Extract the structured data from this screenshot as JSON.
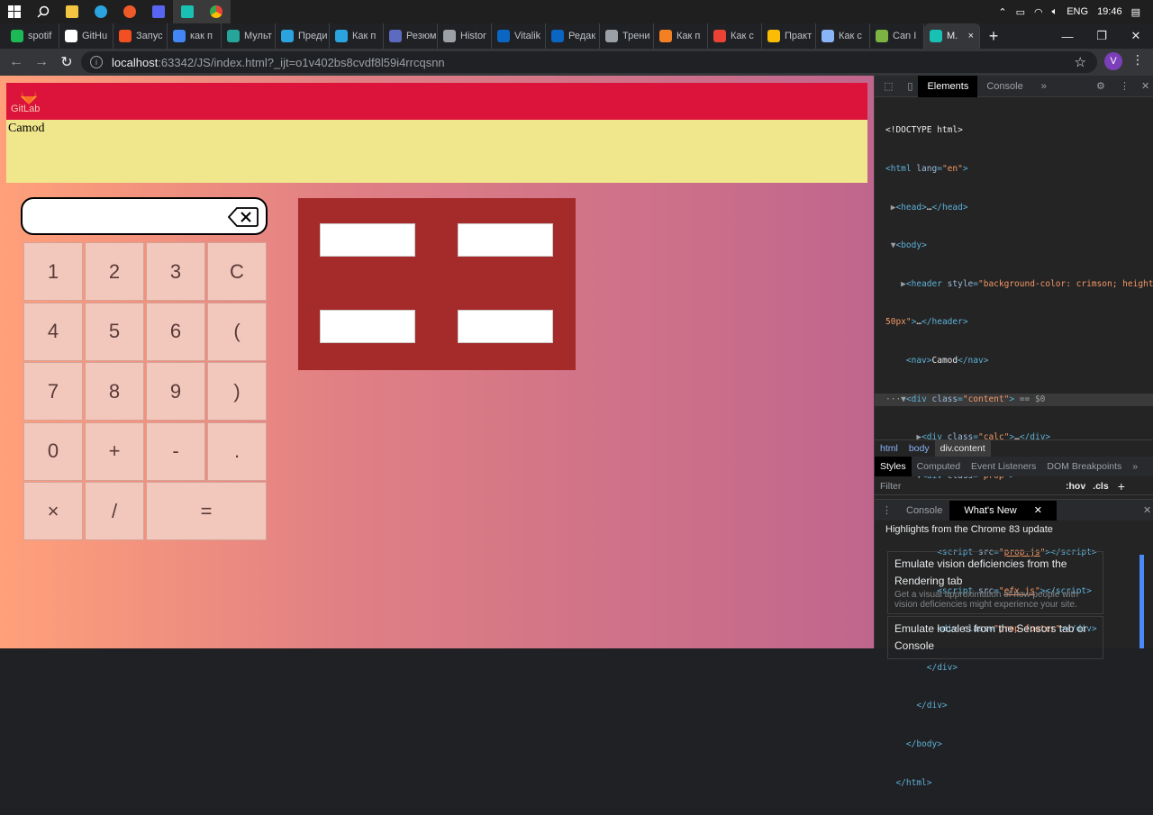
{
  "taskbar": {
    "clock": "19:46",
    "language": "ENG",
    "icons": [
      "windows-start",
      "search",
      "file-explorer",
      "telegram",
      "media-player",
      "discord",
      "jetbrains-webstorm",
      "chrome"
    ]
  },
  "browser": {
    "tabs": [
      {
        "label": "spotif",
        "icon": "spotify-icon",
        "color": "#1db954"
      },
      {
        "label": "GitHu",
        "icon": "github-icon",
        "color": "#ffffff"
      },
      {
        "label": "Запус",
        "icon": "microsoft-icon",
        "color": "#f25022"
      },
      {
        "label": "как п",
        "icon": "google-icon",
        "color": "#4285f4"
      },
      {
        "label": "Мульт",
        "icon": "glasses-icon",
        "color": "#26a69a"
      },
      {
        "label": "Преди",
        "icon": "telegram-icon",
        "color": "#2aa3df"
      },
      {
        "label": "Как п",
        "icon": "telegram-icon",
        "color": "#2aa3df"
      },
      {
        "label": "Резюм",
        "icon": "resume-icon",
        "color": "#5c6bc0"
      },
      {
        "label": "Histor",
        "icon": "history-icon",
        "color": "#9aa0a6"
      },
      {
        "label": "Vitalik",
        "icon": "linkedin-icon",
        "color": "#0a66c2"
      },
      {
        "label": "Редак",
        "icon": "linkedin-icon",
        "color": "#0a66c2"
      },
      {
        "label": "Трени",
        "icon": "graduation-cap-icon",
        "color": "#9aa0a6"
      },
      {
        "label": "Как п",
        "icon": "stackoverflow-icon",
        "color": "#f48024"
      },
      {
        "label": "Как с",
        "icon": "gmail-icon",
        "color": "#ea4335"
      },
      {
        "label": "Практ",
        "icon": "google-icon",
        "color": "#fbbc05"
      },
      {
        "label": "Как с",
        "icon": "gear-icon",
        "color": "#8ab4f8"
      },
      {
        "label": "Can I",
        "icon": "image-icon",
        "color": "#7cb342"
      }
    ],
    "active_tab": {
      "label": "M.",
      "icon": "webstorm-icon",
      "close": "×"
    },
    "new_tab": "+",
    "url_host": "localhost",
    "url_rest": ":63342/JS/index.html?_ijt=o1v402bs8cvdf8l59i4rrcqsnn",
    "profile_initial": "V"
  },
  "page": {
    "logo_text": "GitLab",
    "nav_text": "Camod",
    "calc": {
      "display_value": "",
      "keys": [
        {
          "label": "1"
        },
        {
          "label": "2"
        },
        {
          "label": "3"
        },
        {
          "label": "C"
        },
        {
          "label": "4"
        },
        {
          "label": "5"
        },
        {
          "label": "6"
        },
        {
          "label": "("
        },
        {
          "label": "7"
        },
        {
          "label": "8"
        },
        {
          "label": "9"
        },
        {
          "label": ")"
        },
        {
          "label": "0"
        },
        {
          "label": "+"
        },
        {
          "label": "-"
        },
        {
          "label": "."
        },
        {
          "label": "×"
        },
        {
          "label": "/"
        },
        {
          "label": "="
        }
      ]
    }
  },
  "devtools": {
    "tabs": [
      "Elements",
      "Console"
    ],
    "breadcrumbs": [
      "html",
      "body",
      "div.content"
    ],
    "styles_tabs": [
      "Styles",
      "Computed",
      "Event Listeners",
      "DOM Breakpoints"
    ],
    "filter_placeholder": "Filter",
    "hov": ":hov",
    "cls": ".cls",
    "drawer_tabs": [
      "Console",
      "What's New"
    ],
    "highlights_title": "Highlights from the Chrome 83 update",
    "cards": [
      {
        "title": "Emulate vision deficiencies from the Rendering tab",
        "desc": "Get a visual approximation of how people with vision deficiencies might experience your site."
      },
      {
        "title": "Emulate locales from the Sensors tab or Console",
        "desc": ""
      }
    ]
  }
}
